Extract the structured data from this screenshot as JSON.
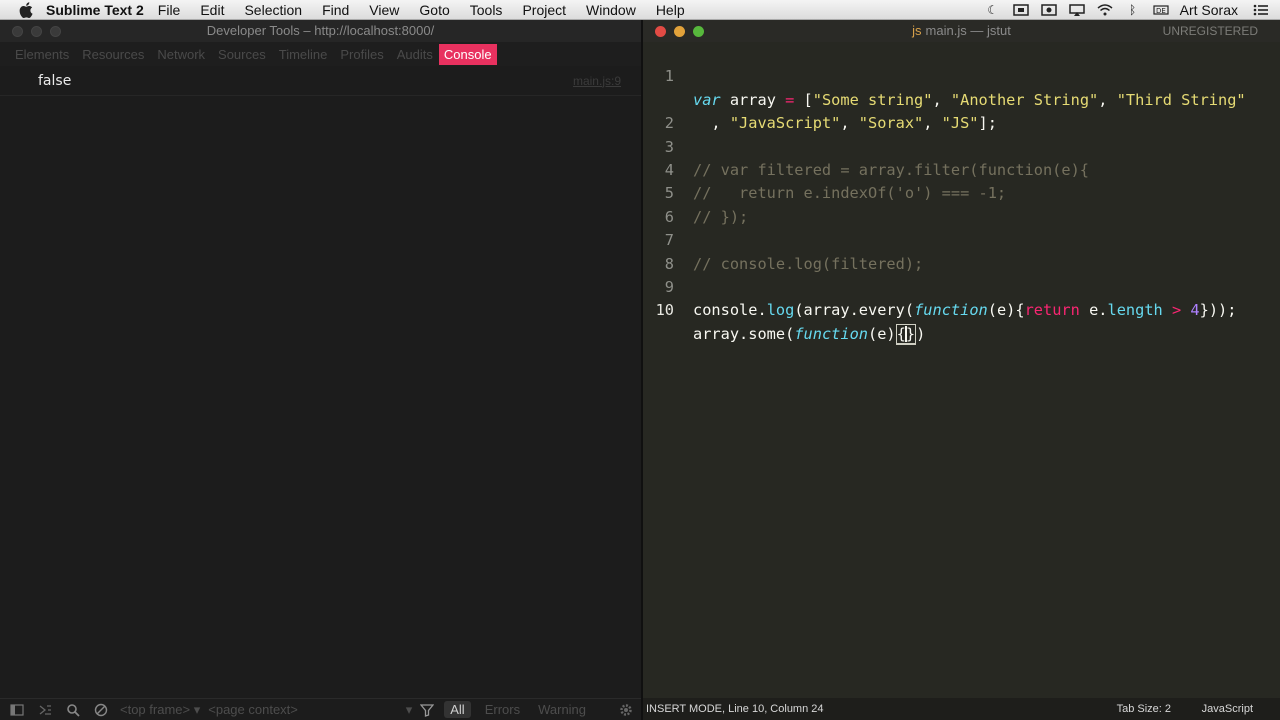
{
  "menubar": {
    "app_name": "Sublime Text 2",
    "items": [
      "File",
      "Edit",
      "Selection",
      "Find",
      "View",
      "Goto",
      "Tools",
      "Project",
      "Window",
      "Help"
    ],
    "user": "Art Sorax"
  },
  "devtools": {
    "title": "Developer Tools – http://localhost:8000/",
    "tabs": [
      "Elements",
      "Resources",
      "Network",
      "Sources",
      "Timeline",
      "Profiles",
      "Audits",
      "Console"
    ],
    "active_tab": "Console",
    "console": {
      "output_value": "false",
      "source_link": "main.js:9"
    },
    "bottom": {
      "frame_select": "<top frame>",
      "context_select": "<page context>",
      "filter_all": "All",
      "filter_errors": "Errors",
      "filter_warnings": "Warning"
    }
  },
  "editor": {
    "title_file": "main.js",
    "title_project": "— jstut",
    "unregistered": "UNREGISTERED",
    "line_numbers": [
      "1",
      "",
      "2",
      "3",
      "4",
      "5",
      "6",
      "7",
      "8",
      "9",
      "10"
    ],
    "status": {
      "mode": "INSERT MODE, Line 10, Column 24",
      "tab_size": "Tab Size: 2",
      "syntax": "JavaScript"
    }
  },
  "colors": {
    "accent_tab": "#e8315f",
    "editor_bg": "#272822",
    "keyword": "#f92672",
    "string": "#e6db74",
    "comment": "#75715e",
    "function": "#66d9ef",
    "number": "#ae81ff"
  }
}
